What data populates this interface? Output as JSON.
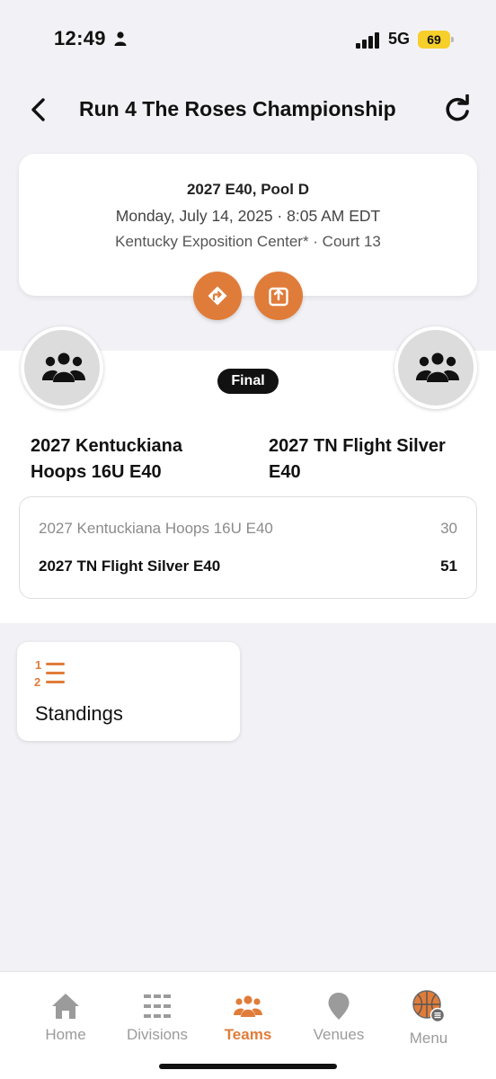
{
  "status_bar": {
    "time": "12:49",
    "network": "5G",
    "battery": "69",
    "battery_color": "#f6cf2b"
  },
  "header": {
    "title": "Run 4 The Roses Championship",
    "back_icon": "chevron-left-icon",
    "refresh_icon": "refresh-icon"
  },
  "game_info": {
    "division_pool": "2027 E40, Pool D",
    "datetime": "Monday, July 14, 2025 · 8:05 AM EDT",
    "location": "Kentucky Exposition Center* · Court 13",
    "actions": [
      {
        "name": "directions",
        "icon": "directions-icon"
      },
      {
        "name": "share",
        "icon": "share-icon"
      }
    ]
  },
  "matchup": {
    "status": "Final",
    "home_team": "2027 Kentuckiana Hoops 16U E40",
    "away_team": "2027 TN Flight Silver E40",
    "scores": [
      {
        "team": "2027 Kentuckiana Hoops 16U E40",
        "score": "30"
      },
      {
        "team": "2027 TN Flight Silver E40",
        "score": "51"
      }
    ]
  },
  "standings": {
    "label": "Standings",
    "icon": "numbered-list-icon"
  },
  "tabs": [
    {
      "label": "Home",
      "icon": "home-icon",
      "active": false
    },
    {
      "label": "Divisions",
      "icon": "divisions-icon",
      "active": false
    },
    {
      "label": "Teams",
      "icon": "teams-icon",
      "active": true
    },
    {
      "label": "Venues",
      "icon": "venue-pin-icon",
      "active": false
    },
    {
      "label": "Menu",
      "icon": "basketball-menu-icon",
      "active": false
    }
  ],
  "colors": {
    "accent": "#e07c3a",
    "background": "#f2f2f6",
    "card": "#ffffff",
    "muted_text": "#8b8b8b"
  }
}
